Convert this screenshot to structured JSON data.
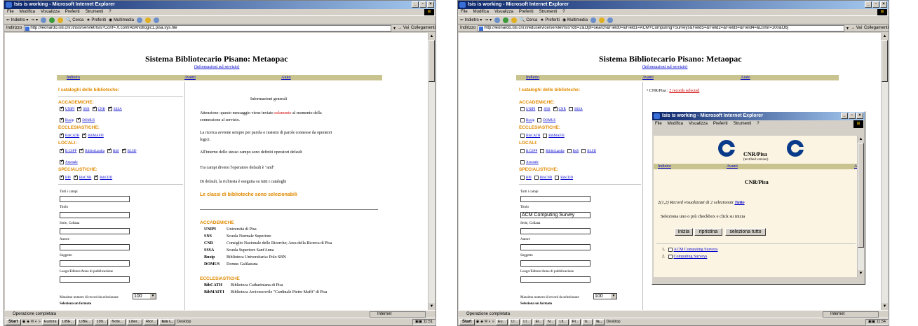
{
  "left": {
    "window_title": "Isis is working - Microsoft Internet Explorer",
    "menu": [
      "File",
      "Modifica",
      "Visualizza",
      "Preferiti",
      "Strumenti",
      "?"
    ],
    "toolbar": [
      "Indietro",
      "Cerca",
      "Preferiti",
      "Multimedia"
    ],
    "address_label": "Indirizzo",
    "address_url": "http://leonardo.isti.cnr.it/isis/servlet/Isis?Conf=./t.conf/AbXhotlogic1.pisa.sys.file",
    "go_label": "Vai",
    "links_label": "Collegamenti",
    "page_title": "Sistema Bibliotecario Pisano: Metaopac",
    "page_subtitle": "(Informazioni sul servizio)",
    "nav": [
      "Indietro",
      "Avanti",
      "Aiuto"
    ],
    "catalogs_heading": "I cataloghi delle biblioteche:",
    "groups": [
      {
        "name": "ACCADEMICHE:",
        "rows": [
          [
            "UNIPI",
            "SNS",
            "CNR",
            "SSSA"
          ],
          [
            "Buxip",
            "DOMUS"
          ]
        ]
      },
      {
        "name": "ECCLESIASTICHE:",
        "rows": [
          [
            "BibCATH",
            "BibMAFFI"
          ]
        ]
      },
      {
        "name": "LOCALI:",
        "rows": [
          [
            "B.CSPP",
            "BibliotLandia",
            "BdS",
            "BLSD"
          ],
          [
            "Arsenale"
          ]
        ]
      },
      {
        "name": "SPECIALISTICHE:",
        "rows": [
          [
            "BPI",
            "BibCNR",
            "BibCDD"
          ]
        ]
      }
    ],
    "fields": [
      "Tutti i campi",
      "Titolo",
      "Serie, Collana",
      "Autore",
      "Soggetto",
      "Luogo/Editore/Anno di pubblicazione"
    ],
    "max_label": "Massimo numero di record da selezionare",
    "max_value": "100",
    "format_label": "Seleziona un formato",
    "info_heading": "Informazioni generali",
    "info_p1_a": "Attenzione: questo messaggio viene inviato ",
    "info_p1_red": "solamente",
    "info_p1_b": " al momento della",
    "info_p1_c": "connessione al servizio.",
    "info_p2_a": "La ricerca avviene sempre per parola o insiemi di parole connesse da operatori",
    "info_p2_b": "logici.",
    "info_p3": "All'interno dello stesso campo sono definiti operatori default",
    "info_p4": "Tra campi diversi l'operatore default è \"and\"",
    "info_p5": "Di default, la richiesta è eseguita su tutti i cataloghi",
    "classes_heading": "Le classi di biblioteche sono selezionabili",
    "acc_heading": "ACCADEMICHE",
    "acc_list": [
      {
        "code": "UNIPI",
        "desc": "Università di Pisa"
      },
      {
        "code": "SNS",
        "desc": "Scuola Normale Superiore"
      },
      {
        "code": "CNR",
        "desc": "Consiglio Nazionale delle Ricerche; Area della Ricerca di Pisa"
      },
      {
        "code": "SSSA",
        "desc": "Scuola Superiore Sant'Anna"
      },
      {
        "code": "Buxip",
        "desc": "Biblioteca Universitaria: Polo SBN"
      },
      {
        "code": "DOMUS",
        "desc": "Domus Galilaeana"
      }
    ],
    "eccl_heading": "ECCLESIASTICHE",
    "eccl_list": [
      {
        "code": "BibCATH",
        "desc": "Biblioteca Cathariniana di Pisa"
      },
      {
        "code": "BibMAFFI",
        "desc": "Biblioteca Arcivescovile \"Cardinale Pietro Maffi\" di Pisa"
      }
    ],
    "status": "Operazione completata",
    "zone": "Internet",
    "taskbar": [
      "Start",
      "Eudora",
      "LIBE...",
      "LIBE...",
      "199...",
      "Note...",
      "Liber...",
      "Rior...",
      "Isis i..."
    ],
    "desktop": "Desktop",
    "clock": "11.51"
  },
  "right": {
    "window_title": "Isis is working - Microsoft Internet Explorer",
    "menu": [
      "File",
      "Modifica",
      "Visualizza",
      "Preferiti",
      "Strumenti",
      "?"
    ],
    "toolbar": [
      "Indietro",
      "Cerca",
      "Preferiti",
      "Multimedia"
    ],
    "address_label": "Indirizzo",
    "address_url": "http://leonardo.isti.cnr.it/eduservice/servlet/Isis?db=2&Opt=search&Field0=&Field1=ACM+Computing+Surveys&Field5=&Field2=&Field3=&Field4=&Dsfor=100&Obj",
    "go_label": "Vai",
    "links_label": "Collegamenti",
    "page_title": "Sistema Bibliotecario Pisano: Metaopac",
    "page_subtitle": "(Informazioni sul servizio)",
    "nav": [
      "Indietro",
      "Avanti",
      "Aiuto"
    ],
    "catalogs_heading": "I cataloghi delle biblioteche:",
    "result_prefix": "CNR/Pisa : ",
    "result_link": "2 records selected",
    "groups": [
      {
        "name": "ACCADEMICHE:",
        "rows": [
          [
            "UNIPI",
            "SNS",
            "CNR",
            "SSSA"
          ],
          [
            "Buxip",
            "DOMUS"
          ]
        ]
      },
      {
        "name": "ECCLESIASTICHE:",
        "rows": [
          [
            "BibCATH",
            "BibMAFFI"
          ]
        ]
      },
      {
        "name": "LOCALI:",
        "rows": [
          [
            "B.CSPP",
            "BiblioLandia",
            "BdS",
            "BLSD"
          ],
          [
            "Arsenale"
          ]
        ]
      },
      {
        "name": "SPECIALISTICHE:",
        "rows": [
          [
            "BPI",
            "BibCNR",
            "BibCDD"
          ]
        ]
      }
    ],
    "fields": [
      "Tutti i campi",
      "Titolo",
      "Serie, Collana",
      "Autore",
      "Soggetto",
      "Luogo/Editore/Anno di pubblicazione"
    ],
    "title_value": "ACM Computing Survey",
    "max_label": "Massimo numero di record da selezionare",
    "max_value": "100",
    "format_label": "Seleziona un formato",
    "status": "Operazione completata",
    "zone": "Internet",
    "taskbar": [
      "Start",
      "Eu...",
      "LI...",
      "LI...",
      "El...",
      "N...",
      "Lll...",
      "Ri...",
      "Is...",
      "Is..."
    ],
    "desktop": "Desktop",
    "clock": "11.54",
    "popup": {
      "window_title": "Isis is working - Microsoft Internet Explorer",
      "menu": [
        "File",
        "Modifica",
        "Visualizza",
        "Preferiti",
        "Strumenti",
        "?"
      ],
      "org": "CNR/Pisa",
      "org_sub": "(text/bed version)",
      "nav": [
        "Indietro",
        "Avanti",
        "A"
      ],
      "heading": "CNR/Pisa",
      "records_text": "2(1,2) Record visualizzati di 2 selezionati ",
      "records_link": "Tutto",
      "instruction": "Seleziona uno o più checkbox e click su inizia",
      "btn_start": "inizia",
      "btn_reset": "ripristina",
      "btn_select_all": "seleziona tutto",
      "results": [
        {
          "num": "1.",
          "title": "ACM Computing Surveys"
        },
        {
          "num": "2.",
          "title": "Computing Surveys"
        }
      ]
    }
  }
}
